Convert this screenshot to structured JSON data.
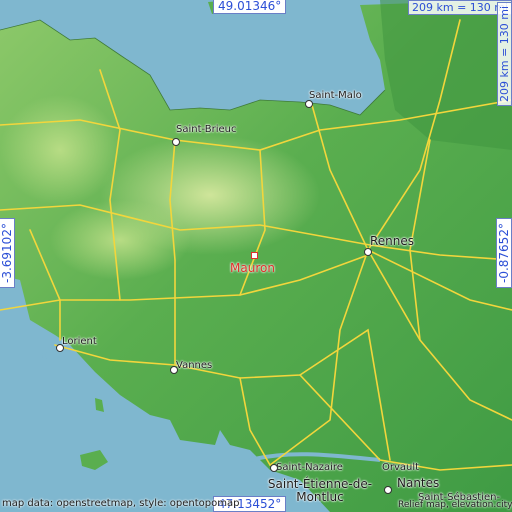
{
  "map": {
    "place": "Mauron",
    "cities": [
      {
        "key": "saint_malo",
        "label": "Saint-Malo"
      },
      {
        "key": "saint_brieuc",
        "label": "Saint-Brieuc"
      },
      {
        "key": "rennes",
        "label": "Rennes"
      },
      {
        "key": "lorient",
        "label": "Lorient"
      },
      {
        "key": "vannes",
        "label": "Vannes"
      },
      {
        "key": "saint_nazaire",
        "label": "Saint-Nazaire"
      },
      {
        "key": "orvault",
        "label": "Orvault"
      },
      {
        "key": "nantes",
        "label": "Nantes"
      },
      {
        "key": "saint_sebastien",
        "label": "Saint-Sébastien-"
      },
      {
        "key": "saint_etienne",
        "label": "Saint-Étienne-de-Montluc"
      }
    ],
    "coords": {
      "top": "49.01346°",
      "bottom": "47.13452°",
      "left": "-3.69102°",
      "right": "-0.87652°"
    },
    "scale_top": "209 km = 130 mi",
    "scale_right": "209 km = 130 mi",
    "credit_left": "map data: openstreetmap, style: opentopomap",
    "credit_right": "Relief map, elevation.city",
    "colors": {
      "sea": "#7fb7cf",
      "lowland": "#4fa64a",
      "upland": "#9ccf6e",
      "road": "#f2d63c",
      "place": "#e0312b",
      "coord_text": "#2c4fd6"
    }
  }
}
